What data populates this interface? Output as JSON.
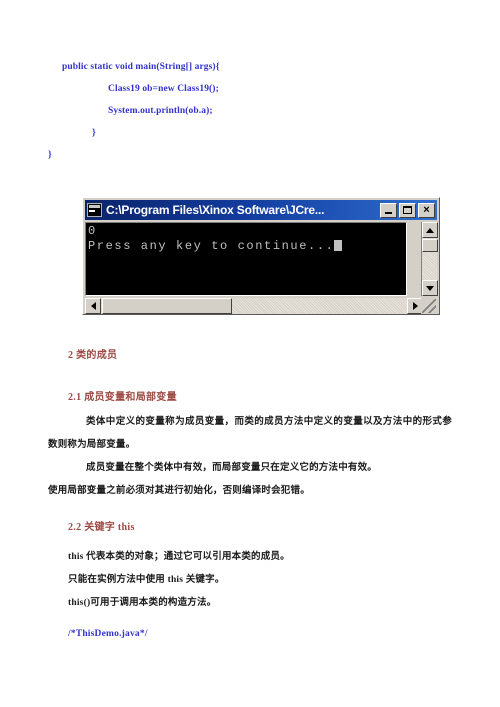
{
  "document": {
    "code_top": {
      "lines": [
        {
          "text": "public static void main(String[] args){",
          "indent": "ind0"
        },
        {
          "text": "Class19 ob=new Class19();",
          "indent": "ind2"
        },
        {
          "text": "System.out.println(ob.a);",
          "indent": "ind2"
        },
        {
          "text": "}",
          "indent": "ind1b"
        },
        {
          "text": "}",
          "indent": "root"
        }
      ]
    },
    "console": {
      "title": "C:\\Program Files\\Xinox Software\\JCre...",
      "icon_name": "console-icon",
      "minimize_label": "_",
      "maximize_label": "□",
      "close_label": "×",
      "output_line_1": "0",
      "output_line_2": "Press any key to continue...",
      "scroll_up_label": "▲",
      "scroll_down_label": "▼",
      "scroll_left_label": "◄",
      "scroll_right_label": "►"
    },
    "sections": {
      "h1_2": "2  类的成员",
      "h2_21": "2.1  成员变量和局部变量",
      "p_21_1": "类体中定义的变量称为成员变量，而类的成员方法中定义的变量以及方法中的形式参数则称为局部变量。",
      "p_21_2": "成员变量在整个类体中有效，而局部变量只在定义它的方法中有效。",
      "p_21_3": "使用局部变量之前必须对其进行初始化，否则编译时会犯错。",
      "h2_22": "2.2  关键字 this",
      "p_22_1": "this 代表本类的对象；通过它可以引用本类的成员。",
      "p_22_2": "只能在实例方法中使用 this 关键字。",
      "p_22_3": "this()可用于调用本类的构造方法。",
      "file_comment": "/*ThisDemo.java*/"
    },
    "colors": {
      "heading": "#9c4a44",
      "code": "#3333cc",
      "body_text": "#1a1a1a",
      "titlebar_start": "#0a246a",
      "titlebar_end": "#2f6fd0",
      "console_bg": "#000000",
      "console_fg": "#c0c0c0",
      "window_face": "#d4d0c8"
    }
  }
}
